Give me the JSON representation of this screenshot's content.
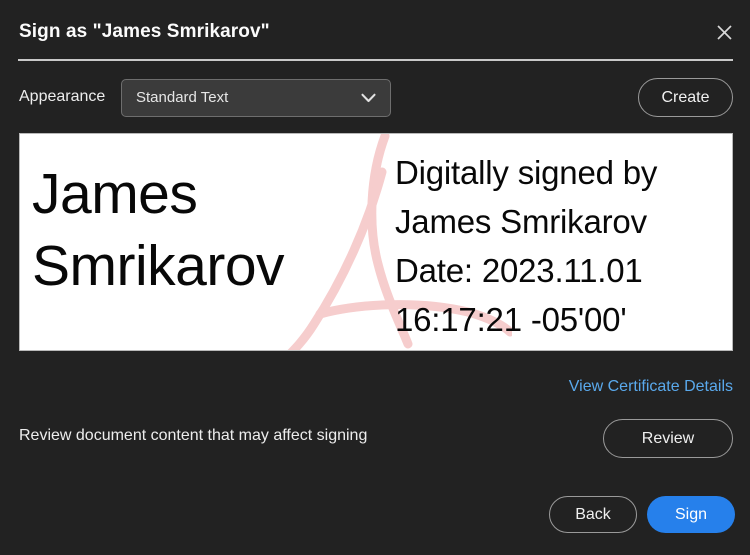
{
  "window": {
    "title": "Sign as \"James Smrikarov\"",
    "close_icon": "close-icon",
    "background_color": "#222222"
  },
  "appearance": {
    "label": "Appearance",
    "selected_option": "Standard Text",
    "chevron_icon": "chevron-down-icon",
    "create_label": "Create"
  },
  "signature_preview": {
    "name_line_1": "James",
    "name_line_2": "Smrikarov",
    "detail_line_1": "Digitally signed by",
    "detail_line_2": "James Smrikarov",
    "detail_line_3": "Date: 2023.11.01",
    "detail_line_4": "16:17:21 -05'00'",
    "watermark_icon": "acrobat-a-watermark-icon",
    "watermark_color": "#f7cfcf",
    "background_color": "#ffffff"
  },
  "certificate": {
    "link_label": "View Certificate Details",
    "link_color": "#5aa9ec"
  },
  "review": {
    "message": "Review document content that may affect signing",
    "button_label": "Review"
  },
  "footer": {
    "back_label": "Back",
    "sign_label": "Sign",
    "sign_accent_color": "#2680eb"
  }
}
